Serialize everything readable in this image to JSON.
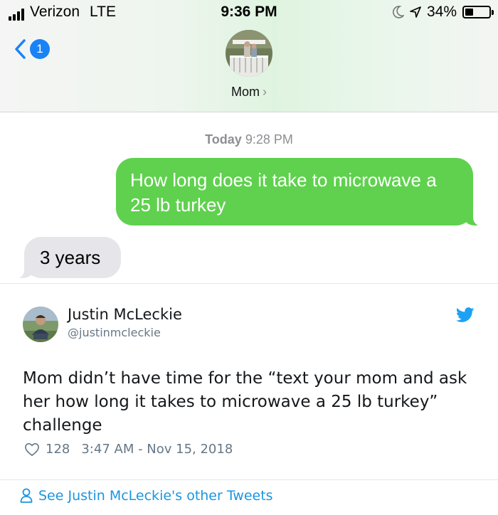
{
  "status_bar": {
    "carrier": "Verizon",
    "network": "LTE",
    "time": "9:36 PM",
    "battery": "34%",
    "battery_level": 0.34
  },
  "conversation": {
    "back_badge": "1",
    "contact_name": "Mom",
    "timestamp_day": "Today",
    "timestamp_time": "9:28 PM",
    "messages": [
      {
        "direction": "outgoing",
        "text": "How long does it take to microwave a 25 lb turkey",
        "color": "#5fd14e"
      },
      {
        "direction": "incoming",
        "text": "3 years",
        "color": "#e5e5ea"
      }
    ]
  },
  "tweet": {
    "author_name": "Justin McLeckie",
    "author_handle": "@justinmcleckie",
    "text": "Mom didn’t have time for the “text your mom and ask her how long it takes to microwave a 25 lb turkey” challenge",
    "likes": "128",
    "timestamp": "3:47 AM - Nov 15, 2018",
    "footer_link": "See Justin McLeckie's other Tweets",
    "brand_color": "#1da1f2"
  },
  "icons": {
    "signal": "signal-bars-icon",
    "moon": "do-not-disturb-moon-icon",
    "location": "location-arrow-icon",
    "battery": "battery-icon",
    "back": "back-chevron-icon",
    "twitter": "twitter-bird-icon",
    "like": "heart-icon",
    "person": "person-icon"
  }
}
